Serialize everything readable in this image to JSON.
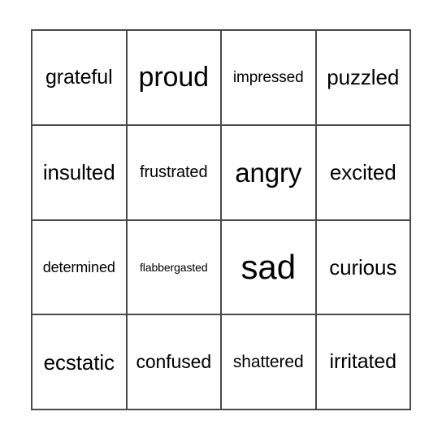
{
  "card": {
    "type": "bingo-card",
    "rows": 4,
    "columns": 4,
    "background_color": "#ffffff",
    "border_color": "#4a4a4a",
    "text_color": "#000000",
    "border_width_px": 2,
    "cells": [
      {
        "label": "grateful",
        "row": 1,
        "col": 1,
        "font_px": 25
      },
      {
        "label": "proud",
        "row": 1,
        "col": 2,
        "font_px": 34
      },
      {
        "label": "impressed",
        "row": 1,
        "col": 3,
        "font_px": 19
      },
      {
        "label": "puzzled",
        "row": 1,
        "col": 4,
        "font_px": 26
      },
      {
        "label": "insulted",
        "row": 2,
        "col": 1,
        "font_px": 26
      },
      {
        "label": "frustrated",
        "row": 2,
        "col": 2,
        "font_px": 20
      },
      {
        "label": "angry",
        "row": 2,
        "col": 3,
        "font_px": 33
      },
      {
        "label": "excited",
        "row": 2,
        "col": 4,
        "font_px": 26
      },
      {
        "label": "determined",
        "row": 3,
        "col": 1,
        "font_px": 18
      },
      {
        "label": "flabbergasted",
        "row": 3,
        "col": 2,
        "font_px": 14
      },
      {
        "label": "sad",
        "row": 3,
        "col": 3,
        "font_px": 42
      },
      {
        "label": "curious",
        "row": 3,
        "col": 4,
        "font_px": 26
      },
      {
        "label": "ecstatic",
        "row": 4,
        "col": 1,
        "font_px": 26
      },
      {
        "label": "confused",
        "row": 4,
        "col": 2,
        "font_px": 23
      },
      {
        "label": "shattered",
        "row": 4,
        "col": 3,
        "font_px": 21
      },
      {
        "label": "irritated",
        "row": 4,
        "col": 4,
        "font_px": 25
      }
    ]
  }
}
